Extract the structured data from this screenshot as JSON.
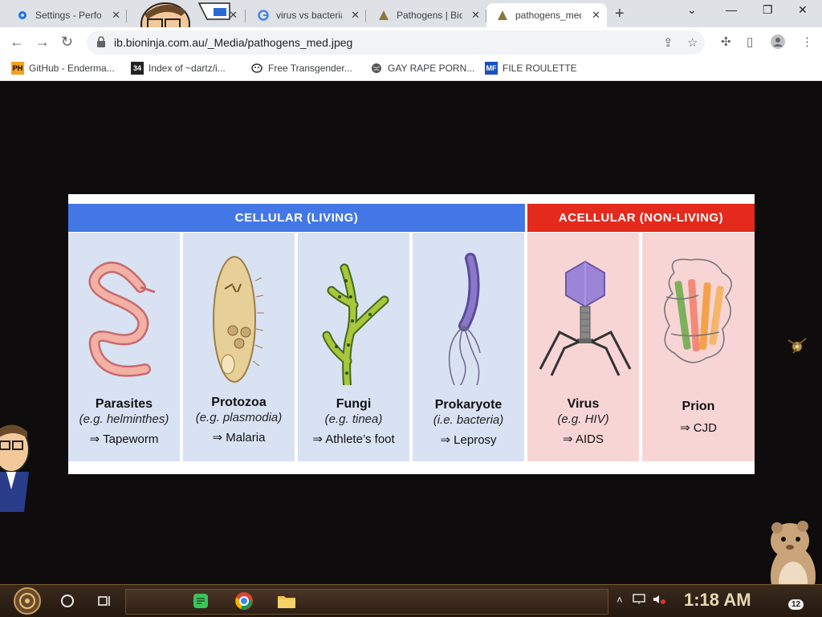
{
  "browser": {
    "tabs": [
      {
        "title": "Settings - Performance",
        "icon": "gear-icon",
        "active": false
      },
      {
        "title": "",
        "icon": "cartoon-face-icon",
        "active": false
      },
      {
        "title": "virus vs bacteria",
        "icon": "google-icon",
        "active": false
      },
      {
        "title": "Pathogens | BioNinja",
        "icon": "bioninja-icon",
        "active": false
      },
      {
        "title": "pathogens_med.jpeg",
        "icon": "bioninja-icon",
        "active": true
      }
    ],
    "new_tab_label": "+",
    "url": "ib.bioninja.com.au/_Media/pathogens_med.jpeg",
    "bookmarks": [
      {
        "label": "GitHub - Enderma...",
        "icon": "PH"
      },
      {
        "label": "Index of ~dartz/i...",
        "icon": "34"
      },
      {
        "label": "Free Transgender...",
        "icon": "mask-icon"
      },
      {
        "label": "GAY RAPE PORN...",
        "icon": "globe-icon"
      },
      {
        "label": "FILE ROULETTE",
        "icon": "MF"
      }
    ]
  },
  "figure": {
    "cellular_header": "CELLULAR  (LIVING)",
    "acellular_header": "ACELLULAR  (NON-LIVING)",
    "colors": {
      "cellular": "#4477e6",
      "acellular": "#e32a1c",
      "cellular_bg": "#d9e2f3",
      "acellular_bg": "#f8d5d5"
    },
    "pathogens": [
      {
        "name": "Parasites",
        "example": "(e.g. helminthes)",
        "disease": "⇒ Tapeworm",
        "group": "cellular"
      },
      {
        "name": "Protozoa",
        "example": "(e.g. plasmodia)",
        "disease": "⇒ Malaria",
        "group": "cellular"
      },
      {
        "name": "Fungi",
        "example": "(e.g. tinea)",
        "disease": "⇒ Athlete’s foot",
        "group": "cellular"
      },
      {
        "name": "Prokaryote",
        "example": "(i.e. bacteria)",
        "disease": "⇒ Leprosy",
        "group": "cellular"
      },
      {
        "name": "Virus",
        "example": "(e.g. HIV)",
        "disease": "⇒ AIDS",
        "group": "acellular"
      },
      {
        "name": "Prion",
        "example": "",
        "disease": "⇒ CJD",
        "group": "acellular"
      }
    ]
  },
  "taskbar": {
    "clock": "1:18 AM",
    "notification_count": "12"
  }
}
